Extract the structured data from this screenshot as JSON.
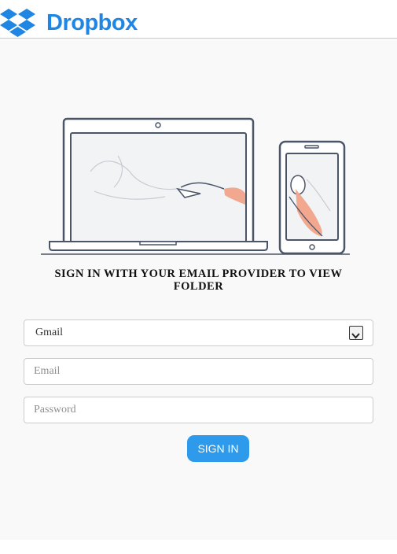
{
  "header": {
    "brand": "Dropbox",
    "brand_color": "#1f86e3",
    "logo_icon": "dropbox-logo-icon"
  },
  "main": {
    "illustration": "laptop-and-phone-illustration",
    "heading": "SIGN IN WITH YOUR EMAIL PROVIDER TO VIEW FOLDER",
    "provider_select": {
      "value": "Gmail",
      "icon": "chevron-down-icon"
    },
    "email": {
      "placeholder": "Email"
    },
    "password": {
      "placeholder": "Password"
    },
    "signin_label": "SIGN IN",
    "signin_color": "#2d9aeb"
  }
}
